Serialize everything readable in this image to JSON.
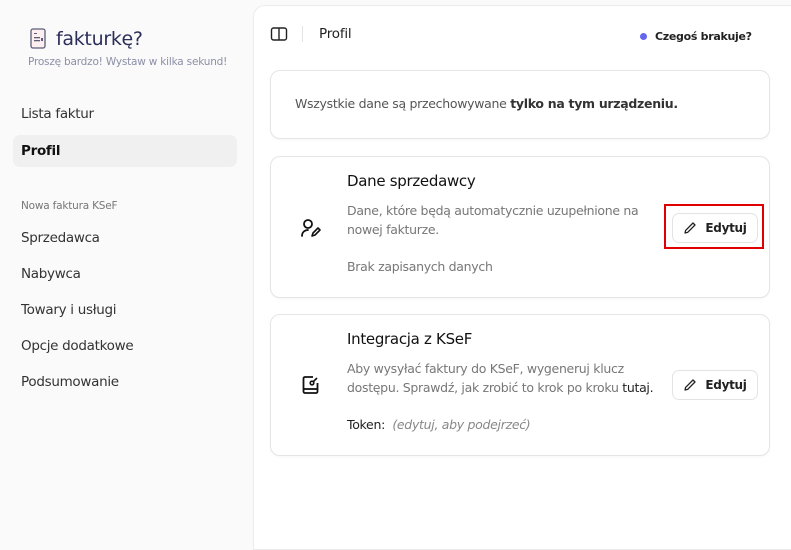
{
  "app": {
    "title": "fakturkę?",
    "tagline": "Proszę bardzo! Wystaw w kilka sekund!",
    "logo_icon": "invoice-document-icon"
  },
  "sidebar": {
    "items": [
      {
        "label": "Lista faktur",
        "active": false
      },
      {
        "label": "Profil",
        "active": true
      }
    ],
    "section_label": "Nowa faktura KSeF",
    "section_items": [
      {
        "label": "Sprzedawca"
      },
      {
        "label": "Nabywca"
      },
      {
        "label": "Towary i usługi"
      },
      {
        "label": "Opcje dodatkowe"
      },
      {
        "label": "Podsumowanie"
      }
    ]
  },
  "header": {
    "breadcrumb": "Profil",
    "feedback_label": "Czegoś brakuje?",
    "feedback_dot_color": "#6366f1"
  },
  "info": {
    "text": "Wszystkie dane są przechowywane ",
    "bold": "tylko na tym urządzeniu."
  },
  "seller_card": {
    "title": "Dane sprzedawcy",
    "description": "Dane, które będą automatycznie uzupełnione na nowej fakturze.",
    "status": "Brak zapisanych danych",
    "button": "Edytuj",
    "icon": "user-pen-icon"
  },
  "ksef_card": {
    "title": "Integracja z KSeF",
    "description": "Aby wysyłać faktury do KSeF, wygeneruj klucz dostępu. Sprawdź, jak zrobić to krok po kroku ",
    "link": "tutaj",
    "link_suffix": ".",
    "token_label": "Token:",
    "token_value": "(edytuj, aby podejrzeć)",
    "button": "Edytuj",
    "icon": "key-card-icon"
  },
  "highlight_color": "#e00000"
}
